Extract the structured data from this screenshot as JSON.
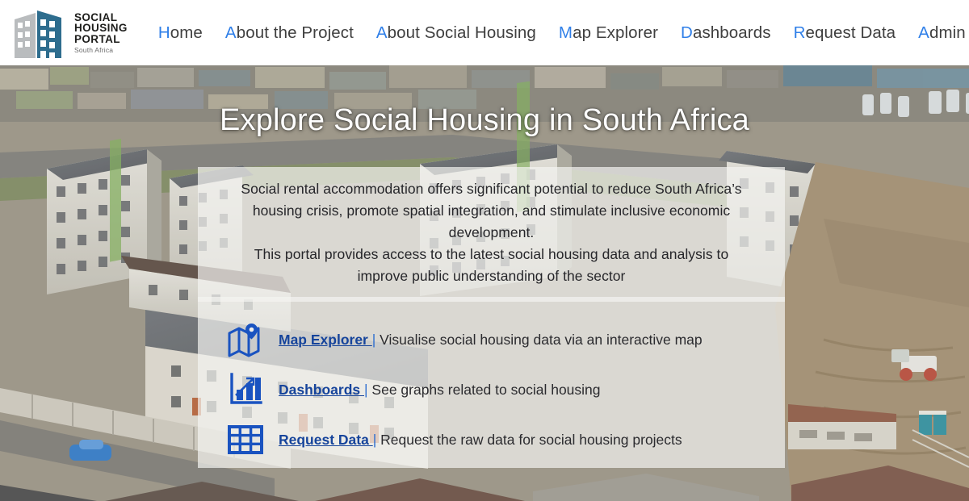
{
  "header": {
    "logo": {
      "icon": "building-logo-icon",
      "line1": "SOCIAL",
      "line2": "HOUSING",
      "line3": "PORTAL",
      "line4": "South Africa",
      "gray_color": "#b9bcbe",
      "blue_color": "#2e6d8e"
    },
    "nav": [
      {
        "label": "Home",
        "first": "H",
        "rest": "ome"
      },
      {
        "label": "About the Project",
        "first": "A",
        "rest": "bout the Project"
      },
      {
        "label": "About Social Housing",
        "first": "A",
        "rest": "bout Social Housing"
      },
      {
        "label": "Map Explorer",
        "first": "M",
        "rest": "ap Explorer"
      },
      {
        "label": "Dashboards",
        "first": "D",
        "rest": "ashboards"
      },
      {
        "label": "Request Data",
        "first": "R",
        "rest": "equest Data"
      },
      {
        "label": "Admin Login",
        "first": "A",
        "rest": "dmin Login"
      }
    ],
    "nav_accent_color": "#2f7fe8",
    "nav_text_color": "#3f3f3f"
  },
  "hero": {
    "title": "Explore Social Housing in South Africa",
    "background_description": "Aerial photograph of a social housing development in South Africa with apartment blocks, informal settlement roofs, roads and an adjacent construction site",
    "intro_lines": [
      "Social rental accommodation offers significant potential to reduce South Africa’s",
      "housing crisis, promote spatial integration, and stimulate inclusive economic development.",
      "This portal provides access to the latest social housing data and analysis to",
      "improve public understanding of the sector"
    ],
    "links": [
      {
        "icon": "map-pin-icon",
        "label": "Map Explorer ",
        "separator": "|",
        "description": " Visualise social housing data via an interactive map"
      },
      {
        "icon": "bar-chart-icon",
        "label": "Dashboards ",
        "separator": "|",
        "description": " See graphs related to social housing"
      },
      {
        "icon": "table-grid-icon",
        "label": "Request Data ",
        "separator": "|",
        "description": " Request the raw data for social housing projects"
      }
    ],
    "link_color": "#16449b",
    "separator_color": "#2f6fd0",
    "icon_color": "#1a53c0",
    "panel_background": "rgba(243,243,241,0.70)"
  }
}
